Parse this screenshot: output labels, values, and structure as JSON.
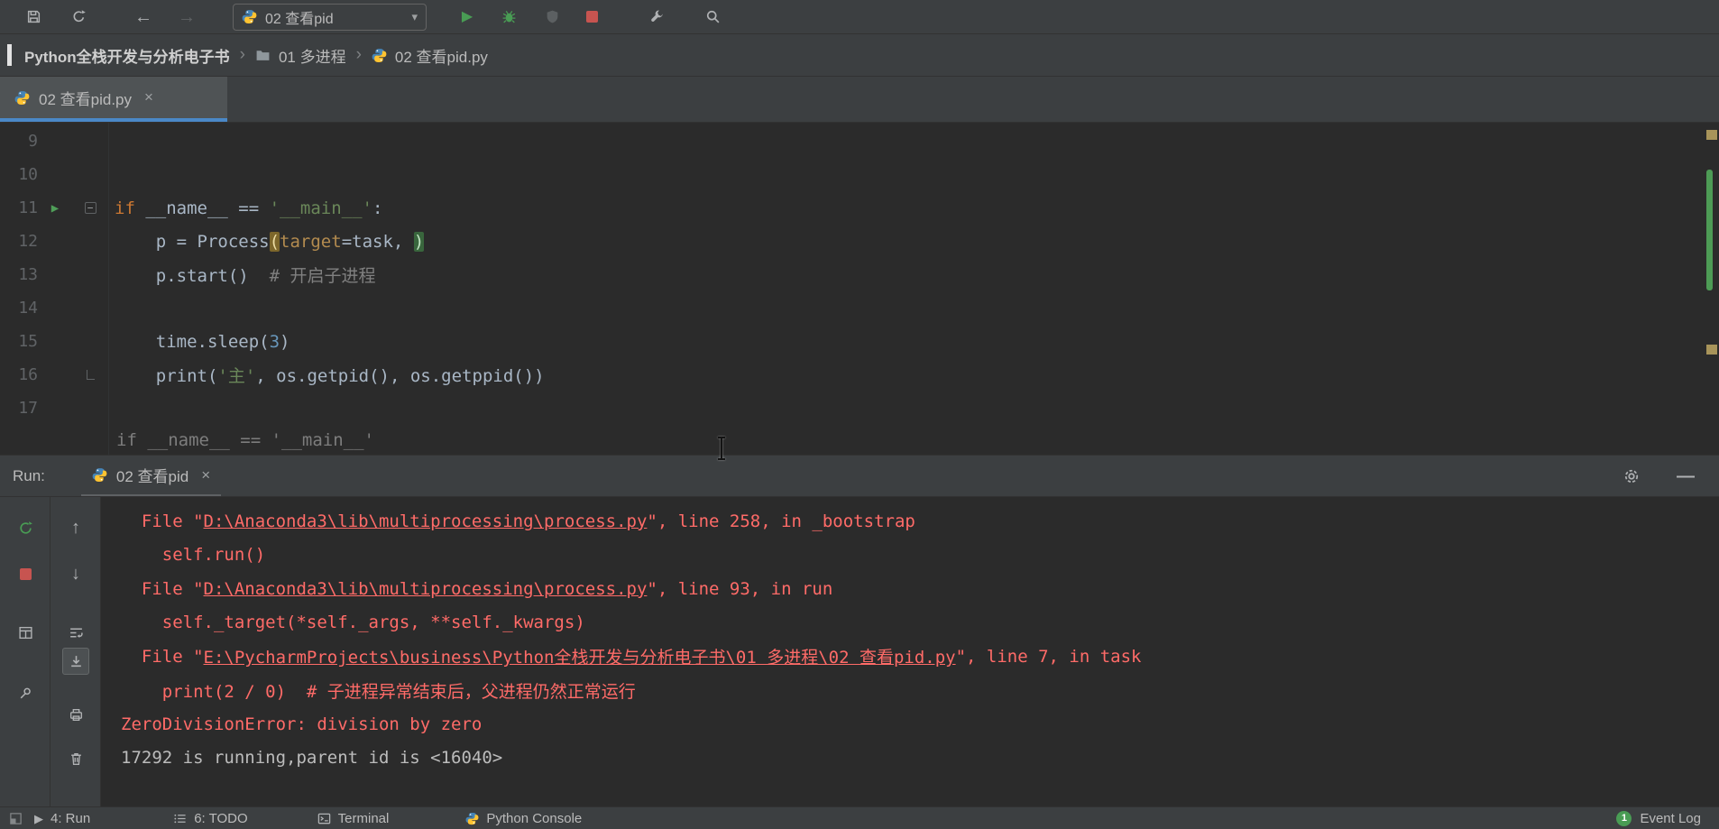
{
  "colors": {
    "toolbar_bg": "#3c3f41",
    "editor_bg": "#2b2b2b",
    "accent_blue": "#4a88c7",
    "error_red": "#ff6b68",
    "run_green": "#499c54",
    "stop_red": "#c75450",
    "keyword_orange": "#cc7832",
    "string_green": "#6a8759",
    "number_blue": "#6897bb",
    "comment_gray": "#808080",
    "line_number_gray": "#606366"
  },
  "icons": {
    "back": "←",
    "forward": "→",
    "caret_down": "▾",
    "run": "▶",
    "chevron": "›",
    "close": "×",
    "up": "↑",
    "down": "↓",
    "minimize": "—",
    "fold_open": "−",
    "run_gutter": "▶",
    "play_small": "▶"
  },
  "toolbar": {
    "run_config": "02 查看pid"
  },
  "navbar": {
    "project": "Python全栈开发与分析电子书",
    "folder": "01 多进程",
    "file": "02 查看pid.py"
  },
  "editor": {
    "tab_label": "02 查看pid.py",
    "context_line": "if __name__ == '__main__'",
    "lines": [
      {
        "n": "9",
        "tokens": []
      },
      {
        "n": "10",
        "tokens": []
      },
      {
        "n": "11",
        "run": true,
        "fold": "open",
        "tokens": [
          [
            "if",
            "kw"
          ],
          [
            " __name__ == ",
            "d"
          ],
          [
            "'__main__'",
            "s"
          ],
          [
            ":",
            "d"
          ]
        ]
      },
      {
        "n": "12",
        "tokens": [
          [
            "    p = Process",
            "d"
          ],
          [
            "(",
            "bo"
          ],
          [
            "target",
            "pa"
          ],
          [
            "=task, ",
            "d"
          ],
          [
            ")",
            "bc"
          ]
        ]
      },
      {
        "n": "13",
        "tokens": [
          [
            "    p.start()  ",
            "d"
          ],
          [
            "# 开启子进程",
            "c"
          ]
        ]
      },
      {
        "n": "14",
        "tokens": []
      },
      {
        "n": "15",
        "tokens": [
          [
            "    time.sleep(",
            "d"
          ],
          [
            "3",
            "n"
          ],
          [
            ")",
            "d"
          ]
        ]
      },
      {
        "n": "16",
        "fold": "end",
        "tokens": [
          [
            "    print(",
            "d"
          ],
          [
            "'主'",
            "s"
          ],
          [
            ", os.getpid(), os.getppid())",
            "d"
          ]
        ]
      },
      {
        "n": "17",
        "tokens": []
      }
    ]
  },
  "run_panel": {
    "label": "Run:",
    "tab_label": "02 查看pid",
    "console": [
      {
        "seg": [
          [
            "  File \"",
            "e"
          ],
          [
            "D:\\Anaconda3\\lib\\multiprocessing\\process.py",
            "l"
          ],
          [
            "\", line 258, in _bootstrap",
            "e"
          ]
        ]
      },
      {
        "seg": [
          [
            "    self.run()",
            "e"
          ]
        ]
      },
      {
        "seg": [
          [
            "  File \"",
            "e"
          ],
          [
            "D:\\Anaconda3\\lib\\multiprocessing\\process.py",
            "l"
          ],
          [
            "\", line 93, in run",
            "e"
          ]
        ]
      },
      {
        "seg": [
          [
            "    self._target(*self._args, **self._kwargs)",
            "e"
          ]
        ]
      },
      {
        "seg": [
          [
            "  File \"",
            "e"
          ],
          [
            "E:\\PycharmProjects\\business\\Python全栈开发与分析电子书\\01 多进程\\02 查看pid.py",
            "l"
          ],
          [
            "\", line 7, in task",
            "e"
          ]
        ]
      },
      {
        "seg": [
          [
            "    print(2 / 0)  # 子进程异常结束后，父进程仍然正常运行",
            "e"
          ]
        ]
      },
      {
        "seg": [
          [
            "ZeroDivisionError: division by zero",
            "e"
          ]
        ]
      },
      {
        "seg": [
          [
            "17292 is running,parent id is <16040>",
            "p"
          ]
        ]
      }
    ]
  },
  "status_bar": {
    "run": "4: Run",
    "todo": "6: TODO",
    "terminal": "Terminal",
    "python_console": "Python Console",
    "event_log": "Event Log",
    "event_count": "1"
  }
}
